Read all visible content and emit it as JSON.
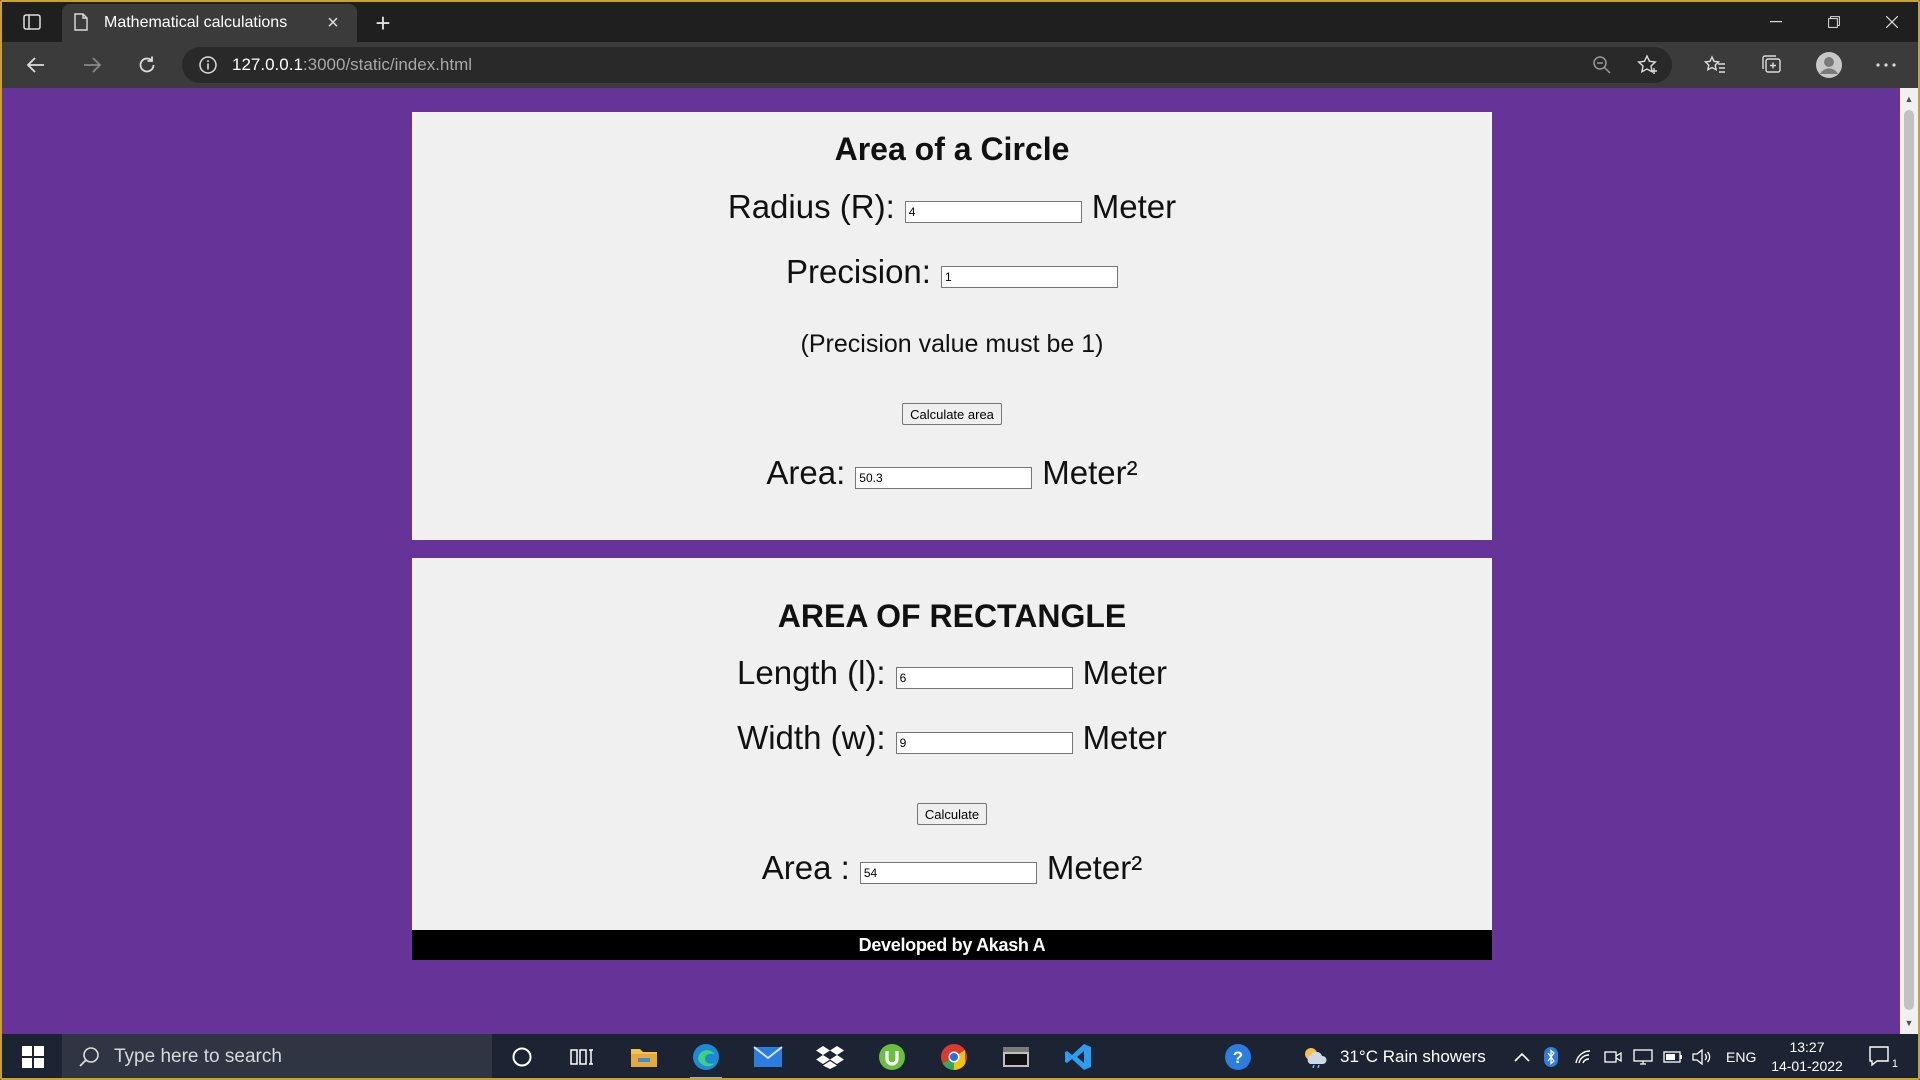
{
  "browser": {
    "tab_title": "Mathematical calculations",
    "url_host": "127.0.0.1",
    "url_rest": ":3000/static/index.html"
  },
  "circle": {
    "title": "Area of a Circle",
    "radius_label": "Radius (R):",
    "radius_value": "4",
    "radius_unit": "Meter",
    "precision_label": "Precision:",
    "precision_value": "1",
    "note": "(Precision value must be 1)",
    "button": "Calculate area",
    "area_label": "Area:",
    "area_value": "50.3",
    "area_unit": "Meter²"
  },
  "rectangle": {
    "title": "AREA OF RECTANGLE",
    "length_label": "Length (l):",
    "length_value": "6",
    "length_unit": "Meter",
    "width_label": "Width (w):",
    "width_value": "9",
    "width_unit": "Meter",
    "button": "Calculate",
    "area_label": "Area :",
    "area_value": "54",
    "area_unit": "Meter²"
  },
  "footer": {
    "text": "Developed by Akash A"
  },
  "taskbar": {
    "search_placeholder": "Type here to search",
    "weather": "31°C  Rain showers",
    "language": "ENG",
    "time": "13:27",
    "date": "14-01-2022",
    "notification_count": "1"
  },
  "colors": {
    "page_bg": "#663399",
    "card_bg": "#f0f0f0",
    "footer_bg": "#000000"
  }
}
